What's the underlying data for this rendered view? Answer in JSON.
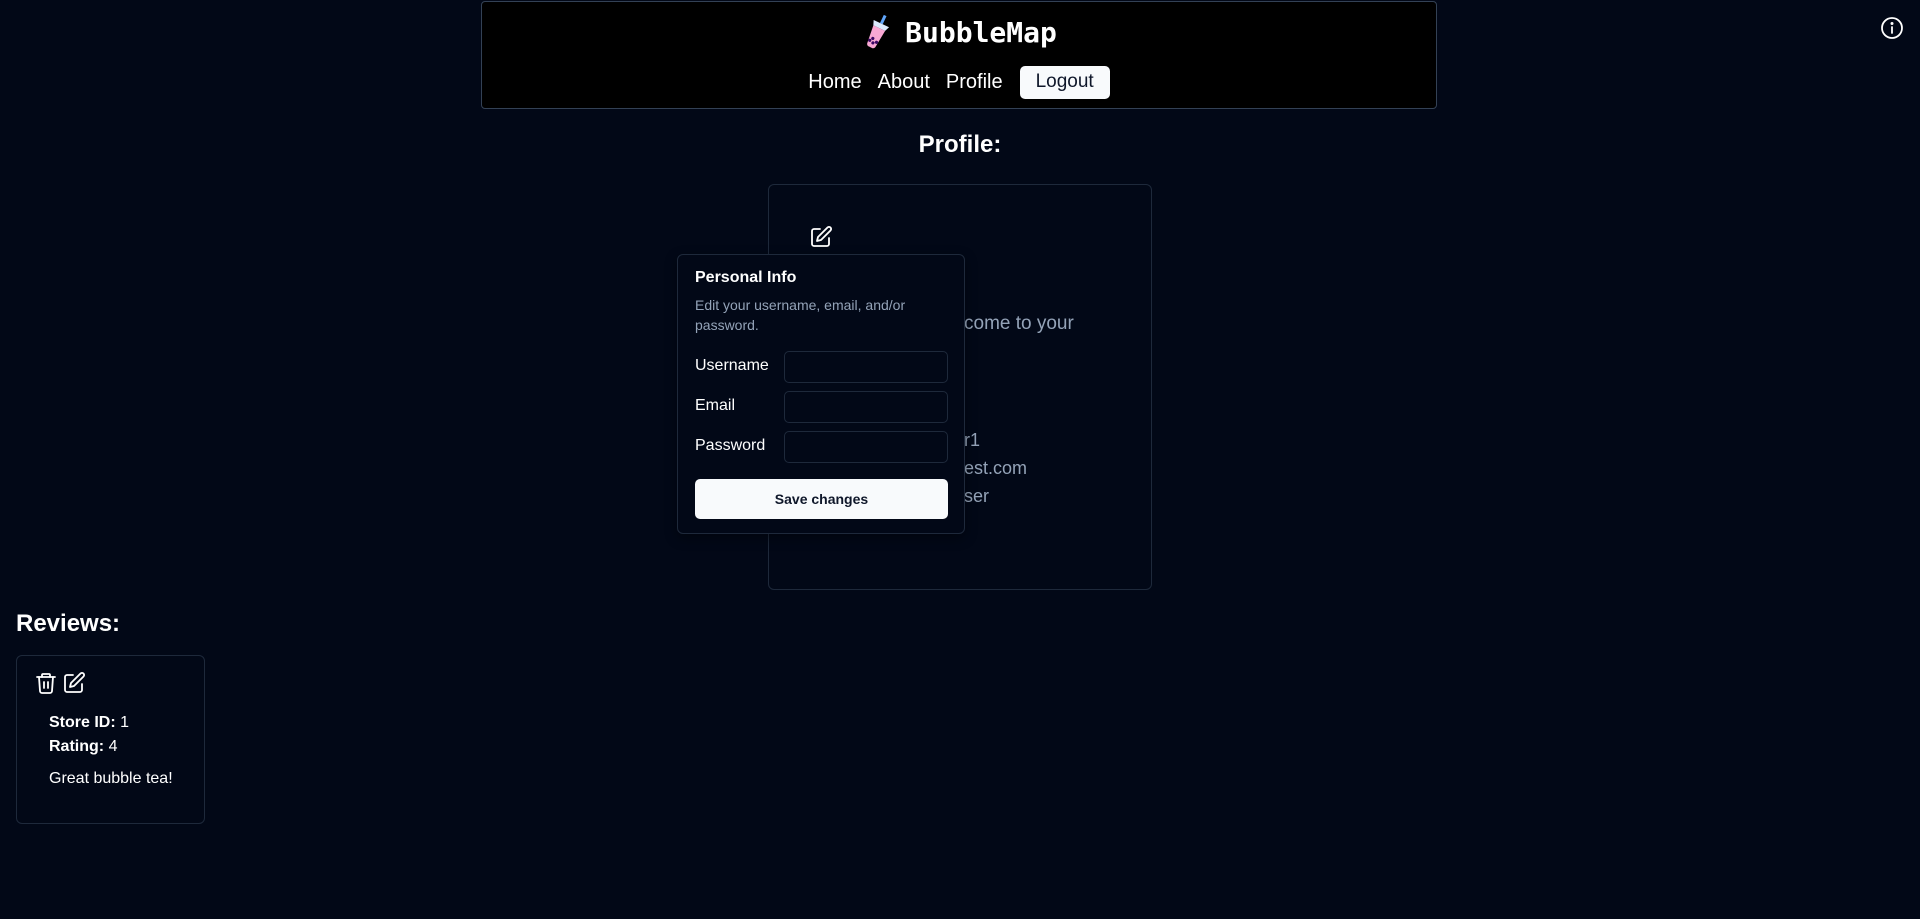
{
  "app": {
    "title": "BubbleMap",
    "logo_icon": "bubble-tea-icon",
    "theme_toggle_icon": "sun-moon-icon",
    "info_icon": "info-icon"
  },
  "nav": {
    "items": [
      "Home",
      "About",
      "Profile"
    ],
    "logout_label": "Logout"
  },
  "profile": {
    "heading": "Profile:",
    "welcome_fragment": "come to your",
    "username_fragment": "r1",
    "email_fragment": "est.com",
    "role_fragment": "ser"
  },
  "popover": {
    "title": "Personal Info",
    "description": "Edit your username, email, and/or password.",
    "fields": {
      "username": {
        "label": "Username",
        "value": ""
      },
      "email": {
        "label": "Email",
        "value": ""
      },
      "password": {
        "label": "Password",
        "value": ""
      }
    },
    "save_label": "Save changes"
  },
  "reviews": {
    "heading": "Reviews:",
    "items": [
      {
        "store_id_label": "Store ID:",
        "store_id": "1",
        "rating_label": "Rating:",
        "rating": "4",
        "text": "Great bubble tea!"
      }
    ]
  },
  "colors": {
    "background": "#020817",
    "header_bg": "#000000",
    "border": "#1e293b",
    "muted_text": "#94a3b8",
    "primary_button": "#f8fafc"
  }
}
